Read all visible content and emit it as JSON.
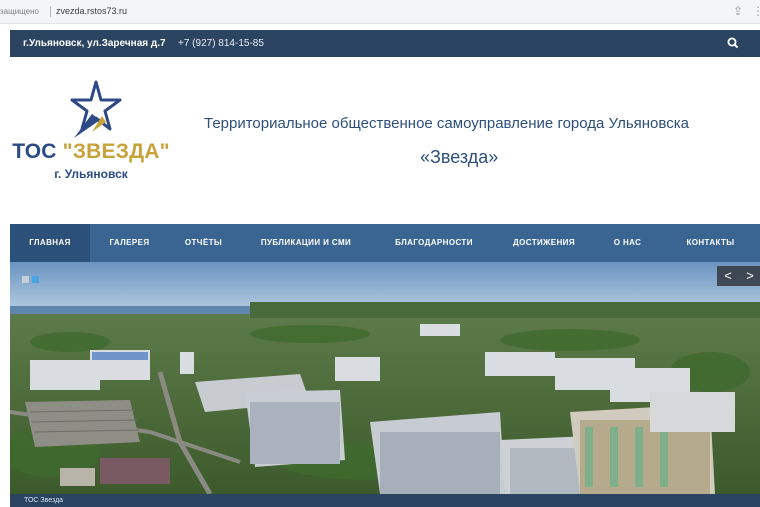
{
  "browser": {
    "security_label": "защищено",
    "url": "zvezda.rstos73.ru"
  },
  "topbar": {
    "address": "г.Ульяновск, ул.Заречная д.7",
    "phone": "+7 (927) 814-15-85",
    "search_icon": "search-icon"
  },
  "logo": {
    "name_prefix": "ТОС ",
    "name_quoted": "\"ЗВЕЗДА\"",
    "city": "г. Ульяновск"
  },
  "header": {
    "title_line1": "Территориальное общественное самоуправление города Ульяновска",
    "title_line2": "«Звезда»"
  },
  "nav": {
    "items": [
      {
        "label": "ГЛАВНАЯ",
        "active": true
      },
      {
        "label": "ГАЛЕРЕЯ",
        "active": false
      },
      {
        "label": "ОТЧЁТЫ",
        "active": false
      },
      {
        "label": "ПУБЛИКАЦИИ И СМИ",
        "active": false
      },
      {
        "label": "БЛАГОДАРНОСТИ",
        "active": false
      },
      {
        "label": "ДОСТИЖЕНИЯ",
        "active": false
      },
      {
        "label": "О НАС",
        "active": false
      },
      {
        "label": "КОНТАКТЫ",
        "active": false
      }
    ]
  },
  "slider": {
    "prev_label": "<",
    "next_label": ">",
    "caption": "ТОС Звезда",
    "current_slide": 2,
    "slide_count": 2
  },
  "colors": {
    "topbar": "#2b4462",
    "nav": "#3a6592",
    "nav_active": "#2b5079",
    "brand_blue": "#2b4a86",
    "brand_gold": "#c8a23a"
  }
}
